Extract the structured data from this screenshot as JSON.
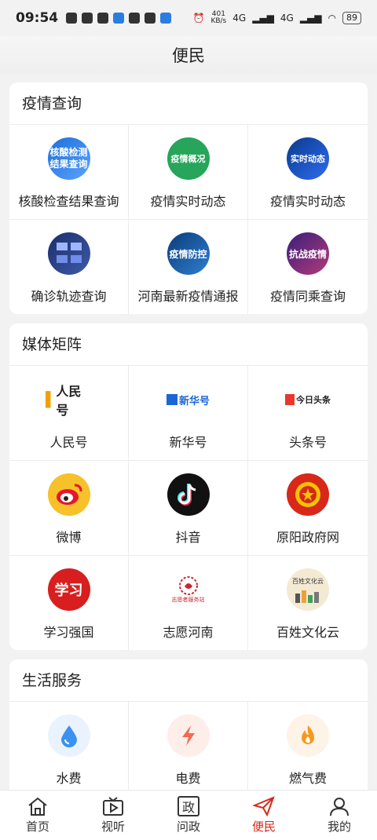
{
  "status_bar": {
    "time": "09:54",
    "speed_value": "401",
    "speed_unit": "KB/s",
    "network_left": "4G",
    "network_right": "4G",
    "battery": "89"
  },
  "header": {
    "title": "便民"
  },
  "sections": [
    {
      "title": "疫情查询",
      "items": [
        {
          "label": "核酸检查结果查询",
          "icon": "nucleic-test-icon",
          "icon_text": "核酸检测结果查询"
        },
        {
          "label": "疫情实时动态",
          "icon": "epidemic-overview-icon",
          "icon_text": "疫情概况"
        },
        {
          "label": "疫情实时动态",
          "icon": "realtime-dynamic-icon",
          "icon_text": "实时动态"
        },
        {
          "label": "确诊轨迹查询",
          "icon": "trajectory-icon",
          "icon_text": ""
        },
        {
          "label": "河南最新疫情通报",
          "icon": "epidemic-prevention-icon",
          "icon_text": "疫情防控"
        },
        {
          "label": "疫情同乘查询",
          "icon": "fight-epidemic-icon",
          "icon_text": "抗战疫情"
        }
      ]
    },
    {
      "title": "媒体矩阵",
      "items": [
        {
          "label": "人民号",
          "icon": "renminhao-logo",
          "icon_text": "人民号"
        },
        {
          "label": "新华号",
          "icon": "xinhuahao-logo",
          "icon_text": "新华号"
        },
        {
          "label": "头条号",
          "icon": "toutiao-logo",
          "icon_text": "今日头条"
        },
        {
          "label": "微博",
          "icon": "weibo-icon",
          "icon_text": ""
        },
        {
          "label": "抖音",
          "icon": "douyin-icon",
          "icon_text": ""
        },
        {
          "label": "原阳政府网",
          "icon": "national-emblem-icon",
          "icon_text": ""
        },
        {
          "label": "学习强国",
          "icon": "xuexi-icon",
          "icon_text": "学习"
        },
        {
          "label": "志愿河南",
          "icon": "volunteer-icon",
          "icon_text": "志愿者服务站"
        },
        {
          "label": "百姓文化云",
          "icon": "culture-cloud-icon",
          "icon_text": "百姓文化云"
        }
      ]
    },
    {
      "title": "生活服务",
      "items": [
        {
          "label": "水费",
          "icon": "water-drop-icon"
        },
        {
          "label": "电费",
          "icon": "lightning-icon"
        },
        {
          "label": "燃气费",
          "icon": "flame-icon"
        }
      ]
    }
  ],
  "tabs": [
    {
      "label": "首页",
      "icon": "home-icon",
      "active": false
    },
    {
      "label": "视听",
      "icon": "tv-play-icon",
      "active": false
    },
    {
      "label": "问政",
      "icon": "zheng-icon",
      "icon_char": "政",
      "active": false
    },
    {
      "label": "便民",
      "icon": "send-arrow-icon",
      "active": true
    },
    {
      "label": "我的",
      "icon": "user-icon",
      "active": false
    }
  ],
  "colors": {
    "accent": "#d7281a",
    "background": "#f2f2f2",
    "card": "#ffffff"
  }
}
